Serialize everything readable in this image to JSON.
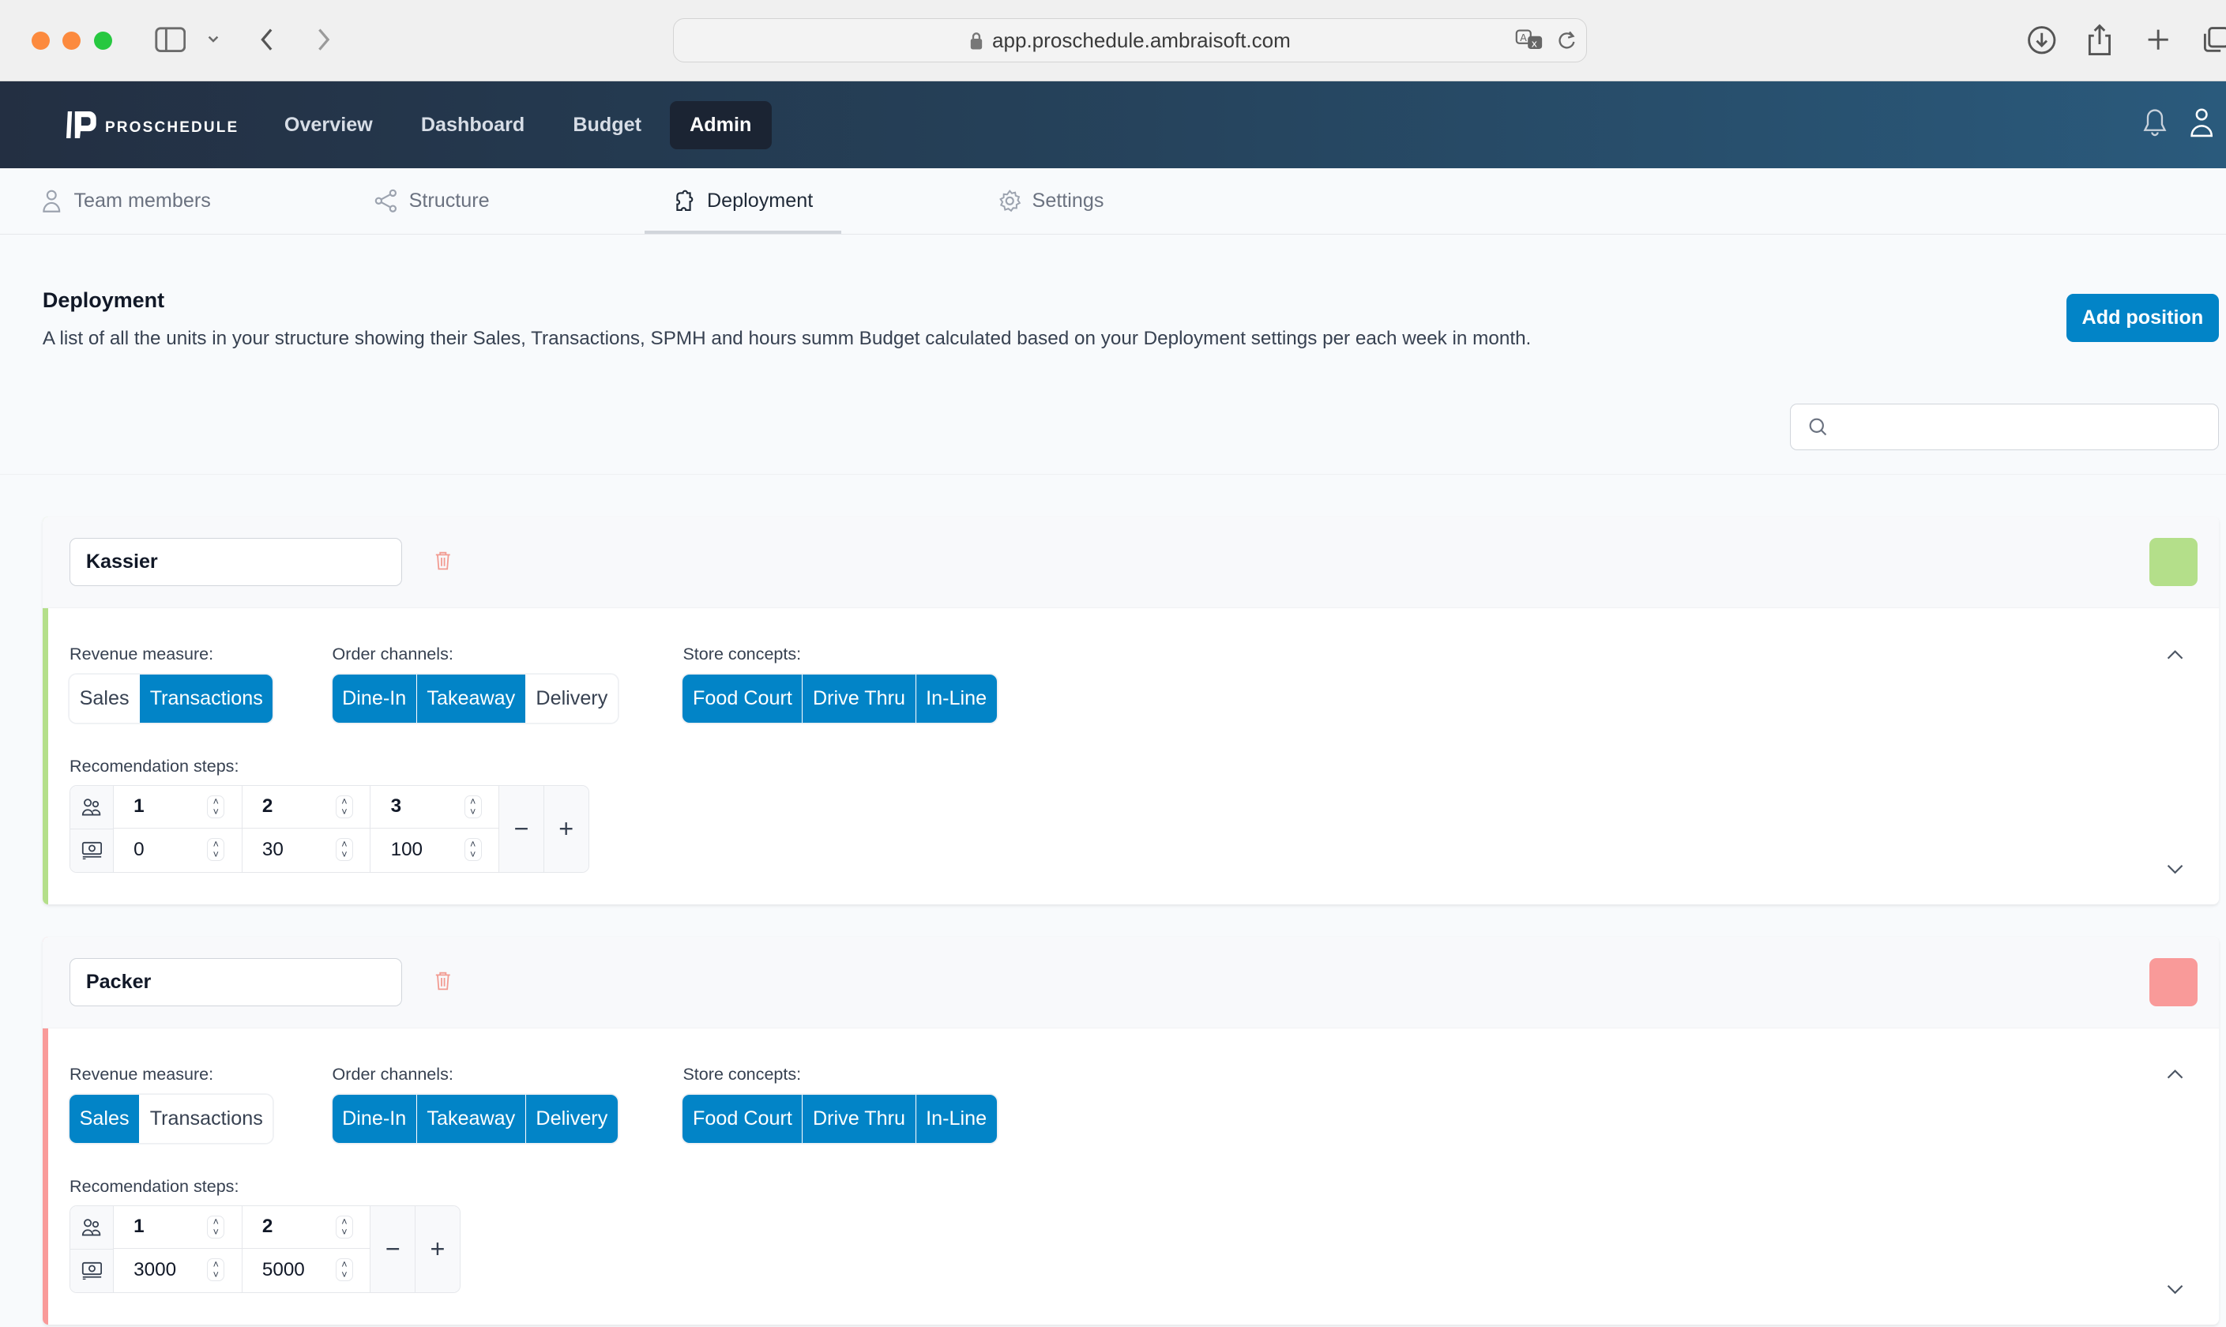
{
  "browser": {
    "url": "app.proschedule.ambraisoft.com"
  },
  "app": {
    "logo_text": "ProSchedule",
    "nav": [
      {
        "label": "Overview",
        "active": false
      },
      {
        "label": "Dashboard",
        "active": false
      },
      {
        "label": "Budget",
        "active": false
      },
      {
        "label": "Admin",
        "active": true
      }
    ]
  },
  "subtabs": [
    {
      "label": "Team members",
      "icon": "user-icon",
      "active": false
    },
    {
      "label": "Structure",
      "icon": "share-icon",
      "active": false
    },
    {
      "label": "Deployment",
      "icon": "puzzle-icon",
      "active": true
    },
    {
      "label": "Settings",
      "icon": "gear-icon",
      "active": false
    }
  ],
  "page": {
    "title": "Deployment",
    "description": "A list of all the units in your structure showing their Sales, Transactions, SPMH and hours summ Budget calculated based on your Deployment settings per each week in month.",
    "add_button": "Add position",
    "search_placeholder": "",
    "search_value": ""
  },
  "labels": {
    "revenue_measure": "Revenue measure:",
    "order_channels": "Order channels:",
    "store_concepts": "Store concepts:",
    "recommendation_steps": "Recomendation steps:",
    "minus": "−",
    "plus": "+"
  },
  "positions": [
    {
      "name": "Kassier",
      "color": "#b4df8a",
      "revenue_measure": [
        {
          "label": "Sales",
          "selected": false
        },
        {
          "label": "Transactions",
          "selected": true
        }
      ],
      "order_channels": [
        {
          "label": "Dine-In",
          "selected": true
        },
        {
          "label": "Takeaway",
          "selected": true
        },
        {
          "label": "Delivery",
          "selected": false
        }
      ],
      "store_concepts": [
        {
          "label": "Food Court",
          "selected": true
        },
        {
          "label": "Drive Thru",
          "selected": true
        },
        {
          "label": "In-Line",
          "selected": true
        }
      ],
      "steps": {
        "people": [
          "1",
          "2",
          "3"
        ],
        "revenue": [
          "0",
          "30",
          "100"
        ]
      }
    },
    {
      "name": "Packer",
      "color": "#f99a99",
      "revenue_measure": [
        {
          "label": "Sales",
          "selected": true
        },
        {
          "label": "Transactions",
          "selected": false
        }
      ],
      "order_channels": [
        {
          "label": "Dine-In",
          "selected": true
        },
        {
          "label": "Takeaway",
          "selected": true
        },
        {
          "label": "Delivery",
          "selected": true
        }
      ],
      "store_concepts": [
        {
          "label": "Food Court",
          "selected": true
        },
        {
          "label": "Drive Thru",
          "selected": true
        },
        {
          "label": "In-Line",
          "selected": true
        }
      ],
      "steps": {
        "people": [
          "1",
          "2"
        ],
        "revenue": [
          "3000",
          "5000"
        ]
      }
    }
  ]
}
